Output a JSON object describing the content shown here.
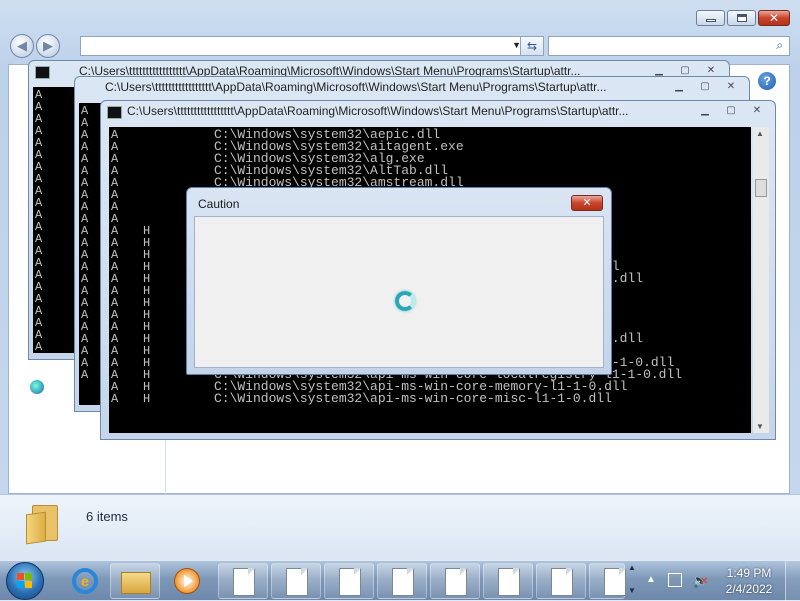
{
  "console": {
    "title": "C:\\Users\\ttttttttttttttttt\\AppData\\Roaming\\Microsoft\\Windows\\Start Menu\\Programs\\Startup\\attr...",
    "title_short": "C:\\Users\\ttttttttttttttttt\\AppData\\Roaming\\Microsoft\\Windows\\Start Menu\\Programs\\Startup\\attr...",
    "lines": [
      {
        "a": "A",
        "h": "",
        "path": "C:\\Windows\\system32\\aepic.dll"
      },
      {
        "a": "A",
        "h": "",
        "path": "C:\\Windows\\system32\\aitagent.exe"
      },
      {
        "a": "A",
        "h": "",
        "path": "C:\\Windows\\system32\\alg.exe"
      },
      {
        "a": "A",
        "h": "",
        "path": "C:\\Windows\\system32\\AltTab.dll"
      },
      {
        "a": "A",
        "h": "",
        "path": "C:\\Windows\\system32\\amstream.dll"
      },
      {
        "a": "A",
        "h": "",
        "path": ""
      },
      {
        "a": "A",
        "h": "",
        "path": ""
      },
      {
        "a": "A",
        "h": "",
        "path": ""
      },
      {
        "a": "A",
        "h": "H",
        "path": "                                              .dll"
      },
      {
        "a": "A",
        "h": "H",
        "path": "                                              0.dll"
      },
      {
        "a": "A",
        "h": "H",
        "path": "                                              ll"
      },
      {
        "a": "A",
        "h": "H",
        "path": "                                              -0.dll"
      },
      {
        "a": "A",
        "h": "H",
        "path": "                                              1-1-0.dll"
      },
      {
        "a": "A",
        "h": "H",
        "path": "                                              dll"
      },
      {
        "a": "A",
        "h": "H",
        "path": "                                              l"
      },
      {
        "a": "A",
        "h": "H",
        "path": "                                              dll"
      },
      {
        "a": "A",
        "h": "H",
        "path": "                                              l"
      },
      {
        "a": "A",
        "h": "H",
        "path": "                                              1-1-0.dll"
      },
      {
        "a": "A",
        "h": "H",
        "path": ""
      },
      {
        "a": "A",
        "h": "H",
        "path": "C:\\Windows\\system32\\api-ms-win-core-localization-l1-1-0.dll"
      },
      {
        "a": "A",
        "h": "H",
        "path": "C:\\Windows\\system32\\api-ms-win-core-localregistry-l1-1-0.dll"
      },
      {
        "a": "A",
        "h": "H",
        "path": "C:\\Windows\\system32\\api-ms-win-core-memory-l1-1-0.dll"
      },
      {
        "a": "A",
        "h": "H",
        "path": "C:\\Windows\\system32\\api-ms-win-core-misc-l1-1-0.dll"
      }
    ]
  },
  "dialog": {
    "title": "Caution",
    "close_label": "✕"
  },
  "window": {
    "minimize": "",
    "maximize": "",
    "close": "✕"
  },
  "address_bar": {
    "value": ""
  },
  "search": {
    "placeholder": ""
  },
  "details": {
    "item_count": "6 items"
  },
  "clock": {
    "time": "1:49 PM",
    "date": "2/4/2022"
  },
  "icons": {
    "help": "?",
    "refresh": "⇆",
    "search": "⌕"
  }
}
